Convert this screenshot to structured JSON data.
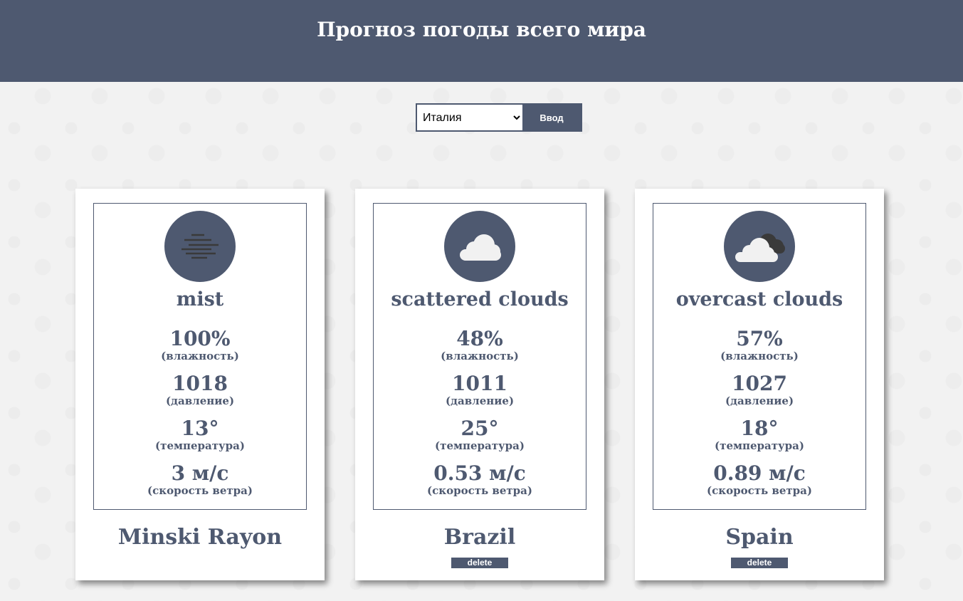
{
  "header": {
    "title": "Прогноз погоды всего мира"
  },
  "form": {
    "selected_country": "Италия",
    "submit_label": "Ввод"
  },
  "labels": {
    "humidity": "(влажность)",
    "pressure": "(давление)",
    "temperature": "(температура)",
    "wind": "(скорость ветра)"
  },
  "colors": {
    "accent": "#4e5970",
    "card_bg": "#ffffff",
    "page_bg": "#f2f2f2"
  },
  "cards": [
    {
      "icon": "mist-icon",
      "description": "mist",
      "humidity": "100%",
      "pressure": "1018",
      "temperature": "13°",
      "wind": "3 м/с",
      "city": "Minski Rayon",
      "delete_label": ""
    },
    {
      "icon": "scattered-clouds-icon",
      "description": "scattered clouds",
      "humidity": "48%",
      "pressure": "1011",
      "temperature": "25°",
      "wind": "0.53 м/с",
      "city": "Brazil",
      "delete_label": "delete"
    },
    {
      "icon": "overcast-clouds-icon",
      "description": "overcast clouds",
      "humidity": "57%",
      "pressure": "1027",
      "temperature": "18°",
      "wind": "0.89 м/с",
      "city": "Spain",
      "delete_label": "delete"
    }
  ]
}
